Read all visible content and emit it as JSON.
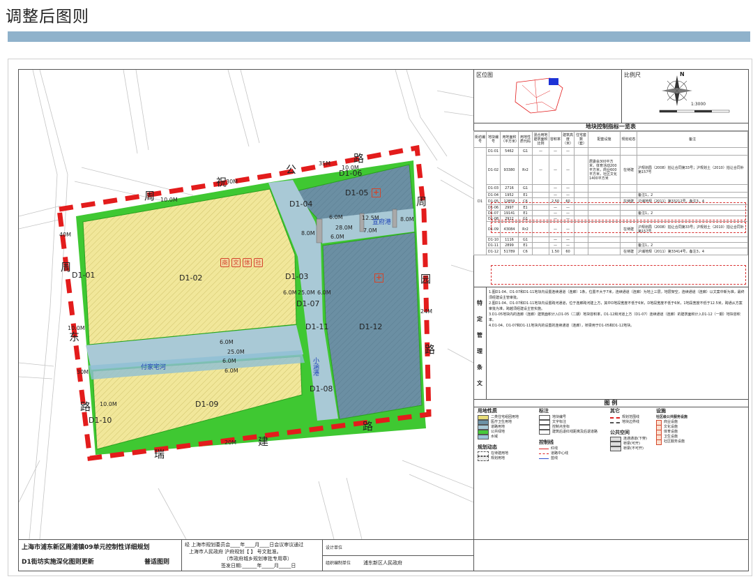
{
  "page": {
    "title": "调整后图则"
  },
  "map": {
    "roads": [
      {
        "text": "祝",
        "ord": 0
      },
      {
        "text": "公",
        "ord": 1
      },
      {
        "text": "路",
        "ord": 2
      },
      {
        "text": "周",
        "ord": 3
      },
      {
        "text": "周",
        "ord": 4
      },
      {
        "text": "东",
        "ord": 5
      },
      {
        "text": "路",
        "ord": 6
      },
      {
        "text": "周",
        "ord": 7
      },
      {
        "text": "园",
        "ord": 8
      },
      {
        "text": "路",
        "ord": 9
      },
      {
        "text": "瑞",
        "ord": 10
      },
      {
        "text": "建",
        "ord": 11
      },
      {
        "text": "路",
        "ord": 12
      }
    ],
    "parcels": [
      "D1-01",
      "D1-02",
      "D1-03",
      "D1-04",
      "D1-05",
      "D1-06",
      "D1-07",
      "D1-08",
      "D1-09",
      "D1-10",
      "D1-11",
      "D1-12"
    ],
    "widths": [
      "35M",
      "30M",
      "10.0M",
      "10.0M",
      "40M",
      "10.0M",
      "30M",
      "24M",
      "8.0M",
      "28.0M",
      "6.0M",
      "6.0M",
      "12.5M",
      "7.0M",
      "8.0M",
      "6.0M",
      "25.0M",
      "6.0M",
      "6.0M",
      "6.0M",
      "25.0M",
      "6.0M",
      "10.0M",
      "20M"
    ],
    "rivers": [
      "付家宅河",
      "小涵港",
      "宣府港"
    ]
  },
  "location_panel": {
    "label": "区位图"
  },
  "scale_panel": {
    "label": "比例尺",
    "north": "N",
    "ratio": "1:3000"
  },
  "table": {
    "title": "地块控制指标一览表",
    "headers": [
      "街坊编号",
      "地块编号",
      "用地面积（平方米）",
      "用地性质代码",
      "混合用地建筑面积比例",
      "容积率",
      "建筑高度（米）",
      "住宅套数（套）",
      "配套设施",
      "规划动态",
      "备注"
    ],
    "block_code": "D1",
    "rows": [
      [
        "D1-01",
        "5462",
        "G1",
        "—",
        "—",
        "—",
        "",
        "",
        "",
        ""
      ],
      [
        "D1-02",
        "93380",
        "Rr2",
        "—",
        "—",
        "—",
        "",
        "居委会300平方米，体育活动200平方米，商业600平方米，社区文化1400平方米",
        "在待建",
        "沪规划局（2008）拍让合同第33号；沪规划土（2010）拍让合同补第157号"
      ],
      [
        "D1-03",
        "2716",
        "G1",
        "",
        "—",
        "—",
        "",
        "",
        "",
        ""
      ],
      [
        "D1-04",
        "1952",
        "E1",
        "",
        "—",
        "—",
        "",
        "",
        "",
        "备注1，2"
      ],
      [
        "D1-05",
        "12859",
        "C6",
        "",
        "2.50",
        "60",
        "",
        "",
        "在待建",
        "沪浦地规（2011）第33212号，备注3，4"
      ],
      [
        "D1-06",
        "2997",
        "E1",
        "",
        "—",
        "—",
        "",
        "",
        "",
        ""
      ],
      [
        "D1-07",
        "19141",
        "E1",
        "",
        "—",
        "—",
        "",
        "",
        "",
        "备注1，2"
      ],
      [
        "D1-08",
        "2912",
        "G1",
        "",
        "—",
        "—",
        "",
        "",
        "",
        ""
      ],
      [
        "D1-09",
        "43084",
        "Rr2",
        "",
        "—",
        "—",
        "",
        "",
        "在待建",
        "沪规划局（2008）拍让合同第33号；沪规划土（2010）拍让合同补第157号"
      ],
      [
        "D1-10",
        "1116",
        "G1",
        "",
        "—",
        "—",
        "",
        "",
        "",
        ""
      ],
      [
        "D1-11",
        "2899",
        "E1",
        "",
        "—",
        "—",
        "",
        "",
        "",
        "备注1，2"
      ],
      [
        "D1-12",
        "51789",
        "C6",
        "",
        "1.50",
        "60",
        "",
        "",
        "在待建",
        "沪浦地规（2011）第33414号，备注3，4"
      ]
    ]
  },
  "notes": {
    "label_chars": [
      "特",
      "定",
      "管",
      "理",
      "条",
      "文"
    ],
    "lines": [
      "1.图D1-04、D1-07和D1-11地块内设置连续通道（连廊）1条，位置不大于7米，连续通道（连廊）为地上三层，地层架空，连续通道（连廊）以文案中新为准，最终须经建设主管审批。",
      "2.图D1-04、D1-07和D1-11地块内设置跨河通道，位于连廊跨河建上方，其中D地段宽度不低于6米，D地段宽度不低于6米，1地段宽度不低于12.5米，跨通从方案审批为准，跨越须经建设主管实施。",
      "3.D1-05地块内的连廊（连廊）建筑面积计入D1-05（二期）地块容积率，D1-12和河道上方（D1-07）连续通道（连廊）的建筑面积计入D1-12（一期）地块容积率。",
      "4.D1-04、D1-07和D1-11地块内的设置的连续通道（连廊），桥梁用于D1-05和D1-12地块。"
    ]
  },
  "legend": {
    "title": "图 例",
    "land_use": {
      "head": "用地性质",
      "items": [
        "二类住宅组团用地",
        "医疗卫生用地",
        "道路用地",
        "公共绿地",
        "水域"
      ],
      "colors": [
        "#e8dd7a",
        "#6d92a6",
        "#a9c9d6",
        "#46c93a",
        "#9bc3d8"
      ]
    },
    "dynamic": {
      "head": "规划动态",
      "items": [
        "在待建用地",
        "规划用地"
      ]
    },
    "notation": {
      "head": "标注",
      "items": [
        "地块编号",
        "文字标注",
        "控制点坐标",
        "建筑后退红线距离及后退道路"
      ]
    },
    "control": {
      "head": "控制线",
      "items": [
        "红线",
        "道路中心线",
        "蓝线"
      ]
    },
    "other": {
      "head": "其它",
      "items": [
        "规划范围线",
        "地块边界线"
      ]
    },
    "public": {
      "head": "公共空间",
      "items": [
        "连通通道(下穿)",
        "桥梁(可开)",
        "桥梁(不可开)"
      ]
    },
    "facilities": {
      "head": "设施",
      "sub": "社区级公共服务设施",
      "items": [
        "商业设施",
        "文化设施",
        "体育设施",
        "卫生设施",
        "社区服务设施"
      ]
    }
  },
  "titleblock": {
    "plan_title": "上海市浦东新区周浦镇09单元控制性详细规划",
    "subtitle": "D1街坊实施深化图则更新",
    "type": "普适图则",
    "approval_line1": "经  上海市规划委员会____年____月____日会议审议通过",
    "approval_line2": "上海市人民政府   沪府规划【        】   号文批准。",
    "approval_line3": "（市政府城乡规划审批专用章）",
    "approval_line4": "签发日期:______年_____月_____日",
    "designer_label": "设计单位",
    "org_label": "组织编制单位",
    "org_value": "浦东新区人民政府"
  }
}
